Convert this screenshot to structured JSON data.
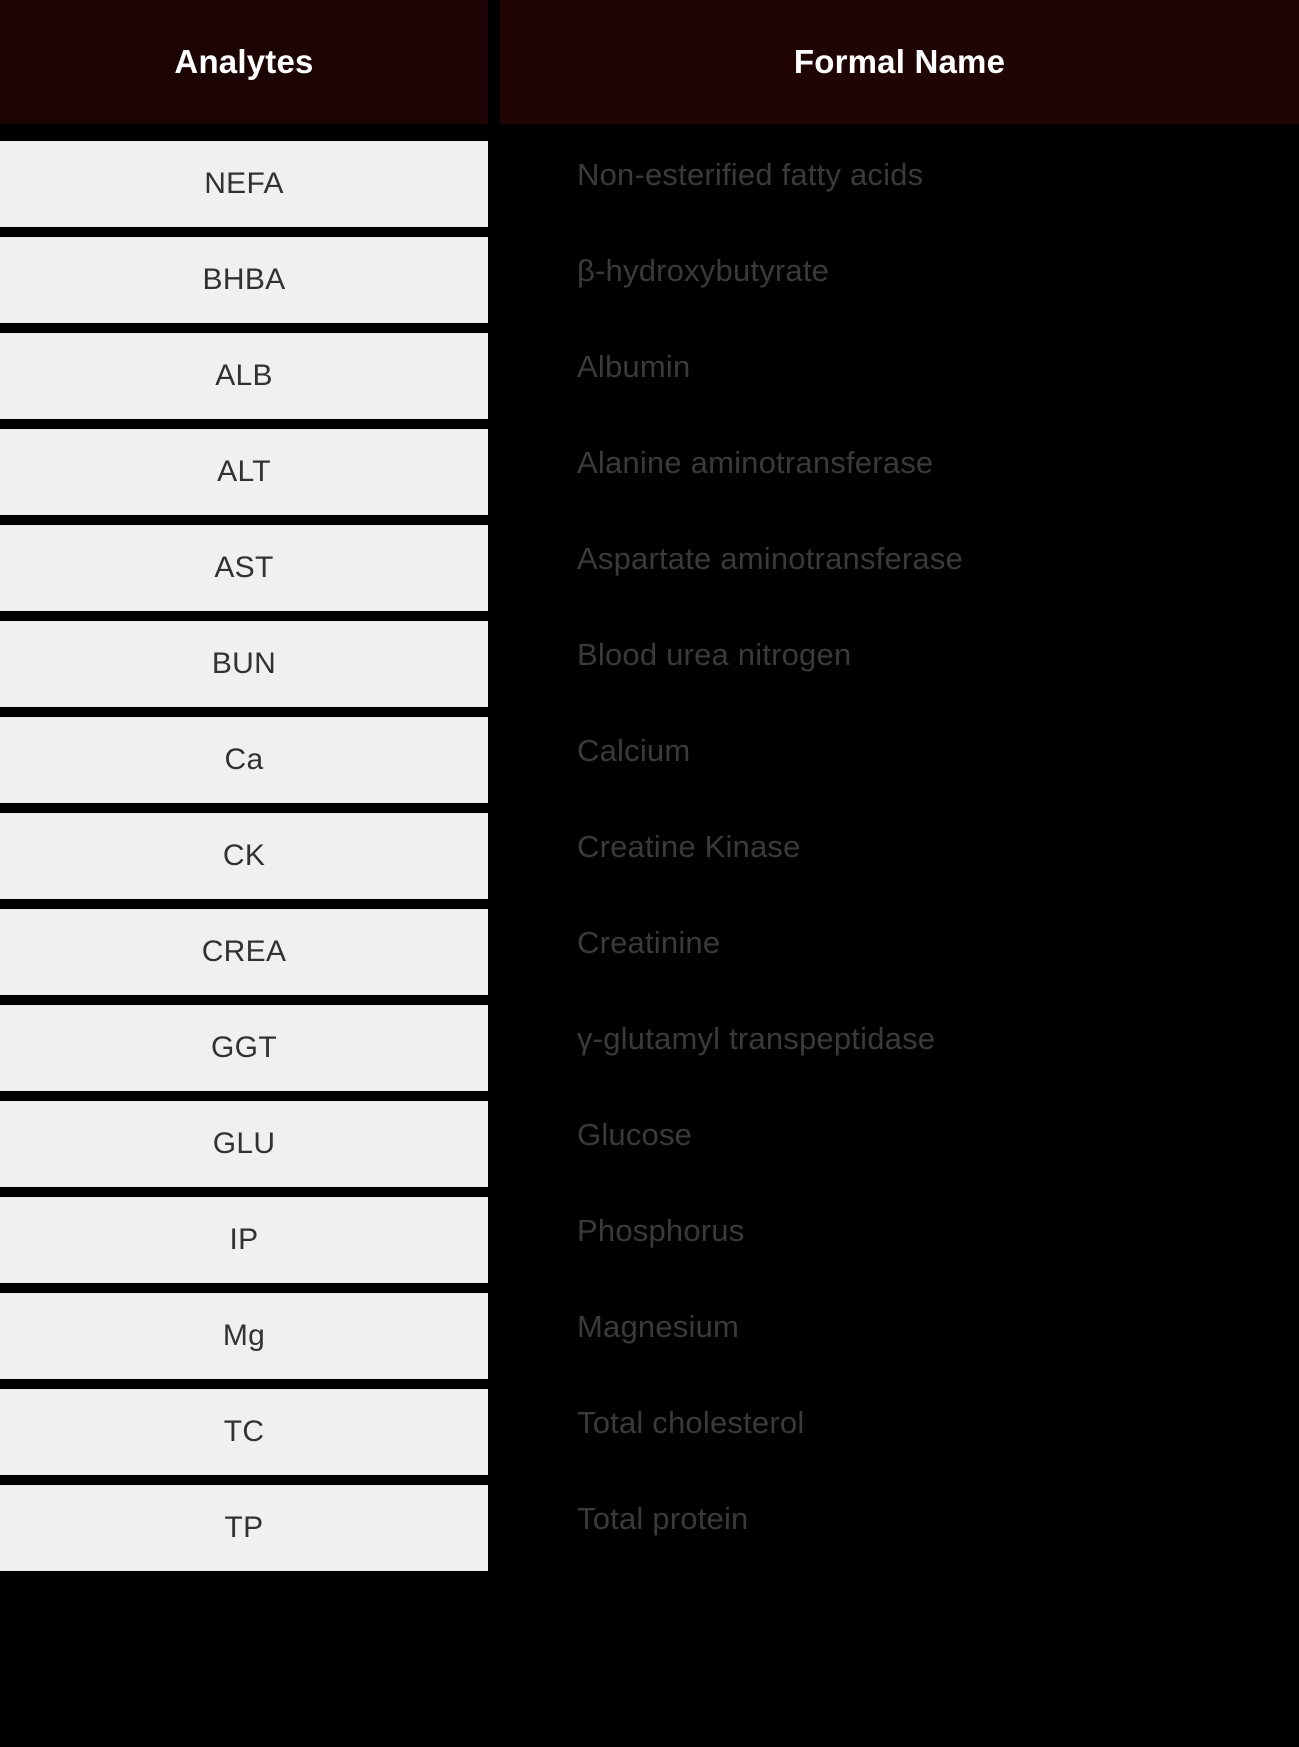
{
  "table": {
    "columns": [
      {
        "key": "analyte",
        "label": "Analytes",
        "align": "center"
      },
      {
        "key": "formal_name",
        "label": "Formal Name",
        "align": "left"
      }
    ],
    "header_bg_left": "#1d0404",
    "header_bg_right": "#200505",
    "header_text_color": "#ffffff",
    "cell_bg_left": "#f0f0f0",
    "cell_text_left": "#323232",
    "cell_bg_right": "#000000",
    "cell_text_right": "#3a3a3a",
    "separator_color": "#000000",
    "rows": [
      {
        "analyte": "NEFA",
        "formal_name": "Non-esterified fatty acids"
      },
      {
        "analyte": "BHBA",
        "formal_name": "β-hydroxybutyrate"
      },
      {
        "analyte": "ALB",
        "formal_name": "Albumin"
      },
      {
        "analyte": "ALT",
        "formal_name": "Alanine aminotransferase"
      },
      {
        "analyte": "AST",
        "formal_name": "Aspartate aminotransferase"
      },
      {
        "analyte": "BUN",
        "formal_name": "Blood urea nitrogen"
      },
      {
        "analyte": "Ca",
        "formal_name": "Calcium"
      },
      {
        "analyte": "CK",
        "formal_name": "Creatine Kinase"
      },
      {
        "analyte": "CREA",
        "formal_name": "Creatinine"
      },
      {
        "analyte": "GGT",
        "formal_name": "γ-glutamyl transpeptidase"
      },
      {
        "analyte": "GLU",
        "formal_name": "Glucose"
      },
      {
        "analyte": "IP",
        "formal_name": "Phosphorus"
      },
      {
        "analyte": "Mg",
        "formal_name": "Magnesium"
      },
      {
        "analyte": "TC",
        "formal_name": "Total cholesterol"
      },
      {
        "analyte": "TP",
        "formal_name": "Total protein"
      }
    ]
  }
}
